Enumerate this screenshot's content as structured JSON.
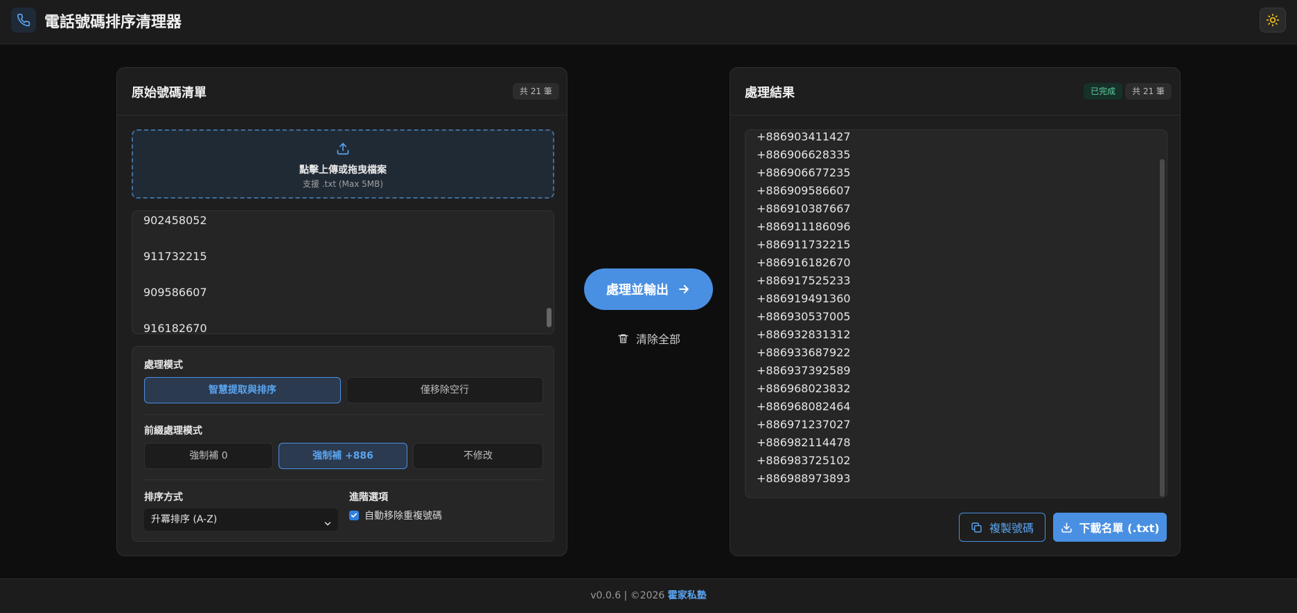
{
  "header": {
    "title": "電話號碼排序清理器",
    "logo_icon": "phone-icon",
    "theme_icon": "sun-icon",
    "accent": "#4a90e2"
  },
  "left_panel": {
    "title": "原始號碼清單",
    "count_badge": "共 21 筆",
    "upload": {
      "icon": "upload-icon",
      "main_text": "點擊上傳或拖曳檔案",
      "sub_text": "支援 .txt (Max 5MB)"
    },
    "input_lines": [
      "902458052",
      "911732215",
      "909586607",
      "916182670"
    ],
    "options": {
      "mode_label": "處理模式",
      "mode_buttons": [
        "智慧提取與排序",
        "僅移除空行"
      ],
      "mode_selected": "智慧提取與排序",
      "prefix_label": "前綴處理模式",
      "prefix_buttons": [
        "強制補 0",
        "強制補 +886",
        "不修改"
      ],
      "prefix_selected": "強制補 +886",
      "sort_label": "排序方式",
      "sort_value": "升冪排序 (A-Z)",
      "advanced_label": "進階選項",
      "dedupe_label": "自動移除重複號碼",
      "dedupe_checked": true
    }
  },
  "middle": {
    "process_label": "處理並輸出",
    "clear_label": "清除全部"
  },
  "right_panel": {
    "title": "處理結果",
    "status_badge": "已完成",
    "count_badge": "共 21 筆",
    "results": [
      "+886903411427",
      "+886906628335",
      "+886906677235",
      "+886909586607",
      "+886910387667",
      "+886911186096",
      "+886911732215",
      "+886916182670",
      "+886917525233",
      "+886919491360",
      "+886930537005",
      "+886932831312",
      "+886933687922",
      "+886937392589",
      "+886968023832",
      "+886968082464",
      "+886971237027",
      "+886982114478",
      "+886983725102",
      "+886988973893"
    ],
    "copy_label": "複製號碼",
    "download_label": "下載名單 (.txt)"
  },
  "footer": {
    "version_text": "v0.0.6 | ©2026 ",
    "brand": "霍家私塾"
  }
}
